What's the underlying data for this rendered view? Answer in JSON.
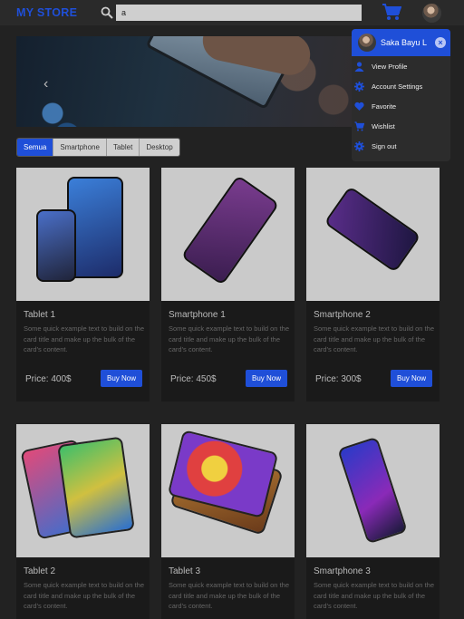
{
  "navbar": {
    "brand": "MY STORE",
    "search_value": "a",
    "icons": [
      "search-icon",
      "cart-icon",
      "avatar"
    ]
  },
  "carousel": {
    "prev_label": "‹"
  },
  "tabs": [
    "Semua",
    "Smartphone",
    "Tablet",
    "Desktop"
  ],
  "active_tab": "Semua",
  "colors": {
    "accent": "#1f4fd8",
    "background": "#222222",
    "card_bg": "#1a1a1a"
  },
  "products": [
    {
      "title": "Tablet 1",
      "text": "Some quick example text to build on the card title and make up the bulk of the card's content.",
      "price": "Price: 400$",
      "button": "Buy Now"
    },
    {
      "title": "Smartphone 1",
      "text": "Some quick example text to build on the card title and make up the bulk of the card's content.",
      "price": "Price: 450$",
      "button": "Buy Now"
    },
    {
      "title": "Smartphone 2",
      "text": "Some quick example text to build on the card title and make up the bulk of the card's content.",
      "price": "Price: 300$",
      "button": "Buy Now"
    },
    {
      "title": "Tablet 2",
      "text": "Some quick example text to build on the card title and make up the bulk of the card's content.",
      "price": "",
      "button": ""
    },
    {
      "title": "Tablet 3",
      "text": "Some quick example text to build on the card title and make up the bulk of the card's content.",
      "price": "",
      "button": ""
    },
    {
      "title": "Smartphone 3",
      "text": "Some quick example text to build on the card title and make up the bulk of the card's content.",
      "price": "",
      "button": ""
    }
  ],
  "dropdown": {
    "user_name": "Saka Bayu L",
    "close_label": "×",
    "items": [
      {
        "label": "View Profile",
        "icon": "user-icon"
      },
      {
        "label": "Account Settings",
        "icon": "gear-icon"
      },
      {
        "label": "Favorite",
        "icon": "heart-icon"
      },
      {
        "label": "Wishlist",
        "icon": "cart-icon"
      },
      {
        "label": "Sign out",
        "icon": "gear-icon"
      }
    ]
  }
}
